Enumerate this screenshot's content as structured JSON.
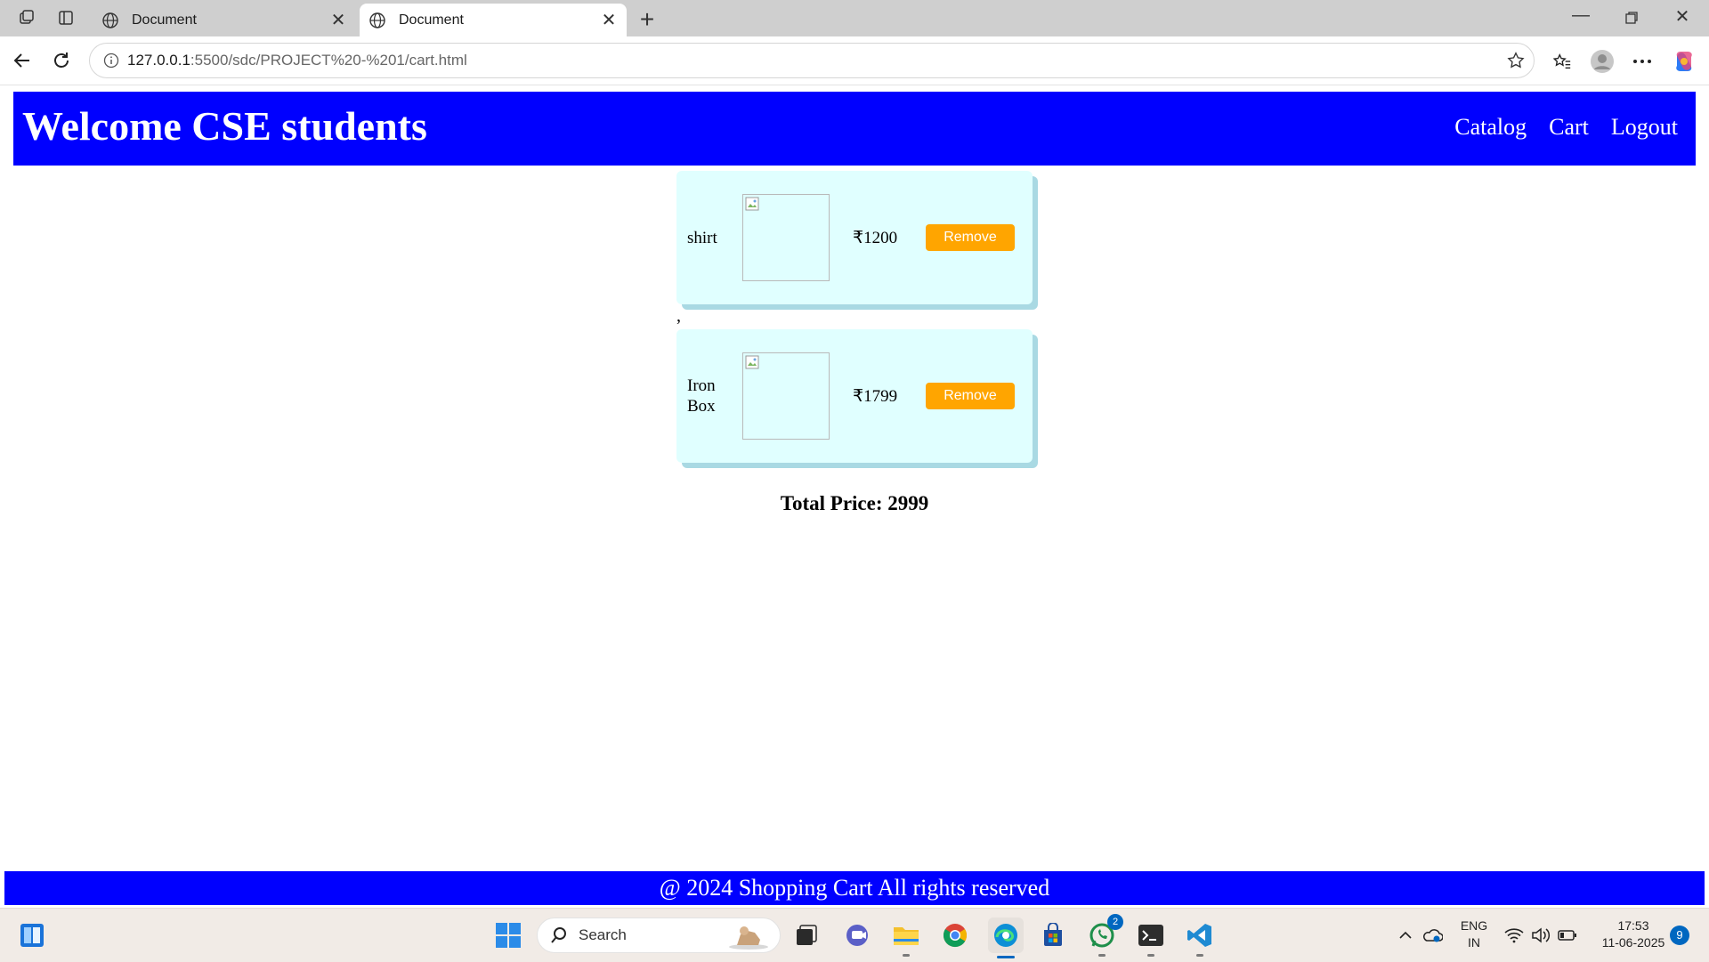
{
  "browser": {
    "tabs": [
      {
        "title": "Document",
        "active": false
      },
      {
        "title": "Document",
        "active": true
      }
    ],
    "address": {
      "host": "127.0.0.1",
      "path": ":5500/sdc/PROJECT%20-%201/cart.html"
    }
  },
  "site": {
    "title": "Welcome CSE students",
    "nav": {
      "catalog": "Catalog",
      "cart": "Cart",
      "logout": "Logout"
    }
  },
  "cart": {
    "items": [
      {
        "name": "shirt",
        "price": "₹1200",
        "remove_label": "Remove"
      },
      {
        "name": "Iron Box",
        "price": "₹1799",
        "remove_label": "Remove"
      }
    ],
    "separator": ",",
    "total_text": "Total Price: 2999"
  },
  "footer": {
    "text": "@ 2024 Shopping Cart All rights reserved"
  },
  "taskbar": {
    "search_label": "Search",
    "whatsapp_badge": "2",
    "lang_line1": "ENG",
    "lang_line2": "IN",
    "time": "17:53",
    "date": "11-06-2025",
    "notifications": "9"
  },
  "colors": {
    "header_bg": "#0000ff",
    "card_bg": "#e0ffff",
    "remove_btn": "#ffa500",
    "footer_bg": "#0000ff"
  }
}
